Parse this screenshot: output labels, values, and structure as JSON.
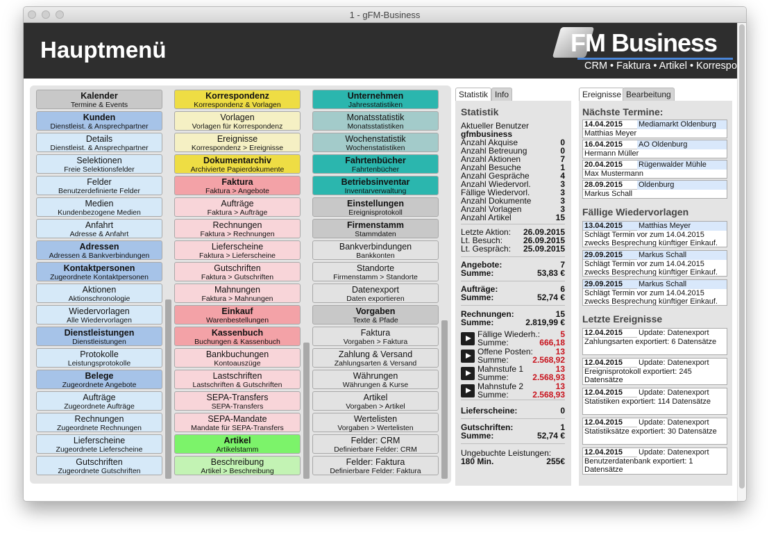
{
  "window": {
    "title": "1 - gFM-Business"
  },
  "header": {
    "title": "Hauptmenü",
    "logo_text": "FM Business",
    "logo_sub": "CRM • Faktura • Artikel • Korrespondenz"
  },
  "columns": [
    [
      {
        "t": "Kalender",
        "s": "Termine & Events",
        "v": "grey",
        "b": true
      },
      {
        "t": "Kunden",
        "s": "Dienstleist. & Ansprechpartner",
        "v": "dblue",
        "b": true
      },
      {
        "t": "Details",
        "s": "Dienstleist. & Ansprechpartner",
        "v": "lblue",
        "b": false
      },
      {
        "t": "Selektionen",
        "s": "Freie Selektionsfelder",
        "v": "lblue",
        "b": false
      },
      {
        "t": "Felder",
        "s": "Benutzerdefinierte Felder",
        "v": "lblue",
        "b": false
      },
      {
        "t": "Medien",
        "s": "Kundenbezogene Medien",
        "v": "lblue",
        "b": false
      },
      {
        "t": "Anfahrt",
        "s": "Adresse & Anfahrt",
        "v": "lblue",
        "b": false
      },
      {
        "t": "Adressen",
        "s": "Adressen & Bankverbindungen",
        "v": "dblue",
        "b": true
      },
      {
        "t": "Kontaktpersonen",
        "s": "Zugeordnete Kontaktpersonen",
        "v": "dblue",
        "b": true
      },
      {
        "t": "Aktionen",
        "s": "Aktionschronologie",
        "v": "lblue",
        "b": false
      },
      {
        "t": "Wiedervorlagen",
        "s": "Alle Wiedervorlagen",
        "v": "lblue",
        "b": false
      },
      {
        "t": "Dienstleistungen",
        "s": "Dienstleistungen",
        "v": "dblue",
        "b": true
      },
      {
        "t": "Protokolle",
        "s": "Leistungsprotokolle",
        "v": "lblue",
        "b": false
      },
      {
        "t": "Belege",
        "s": "Zugeordnete Angebote",
        "v": "dblue",
        "b": true
      },
      {
        "t": "Aufträge",
        "s": "Zugeordnete Aufträge",
        "v": "lblue",
        "b": false
      },
      {
        "t": "Rechnungen",
        "s": "Zugeordnete Rechnungen",
        "v": "lblue",
        "b": false
      },
      {
        "t": "Lieferscheine",
        "s": "Zugeordnete Lieferscheine",
        "v": "lblue",
        "b": false
      },
      {
        "t": "Gutschriften",
        "s": "Zugeordnete Gutschriften",
        "v": "lblue",
        "b": false
      }
    ],
    [
      {
        "t": "Korrespondenz",
        "s": "Korrespondenz & Vorlagen",
        "v": "yellow",
        "b": true
      },
      {
        "t": "Vorlagen",
        "s": "Vorlagen für Korrespondenz",
        "v": "lyellow",
        "b": false
      },
      {
        "t": "Ereignisse",
        "s": "Korrespondenz > Ereignisse",
        "v": "lyellow",
        "b": false
      },
      {
        "t": "Dokumentarchiv",
        "s": "Archivierte Papierdokumente",
        "v": "yellow",
        "b": true
      },
      {
        "t": "Faktura",
        "s": "Faktura > Angebote",
        "v": "dpink",
        "b": true
      },
      {
        "t": "Aufträge",
        "s": "Faktura > Aufträge",
        "v": "lpink",
        "b": false
      },
      {
        "t": "Rechnungen",
        "s": "Faktura > Rechnungen",
        "v": "lpink",
        "b": false
      },
      {
        "t": "Lieferscheine",
        "s": "Faktura > Lieferscheine",
        "v": "lpink",
        "b": false
      },
      {
        "t": "Gutschriften",
        "s": "Faktura > Gutschriften",
        "v": "lpink",
        "b": false
      },
      {
        "t": "Mahnungen",
        "s": "Faktura > Mahnungen",
        "v": "lpink",
        "b": false
      },
      {
        "t": "Einkauf",
        "s": "Warenbestellungen",
        "v": "dpink",
        "b": true
      },
      {
        "t": "Kassenbuch",
        "s": "Buchungen & Kassenbuch",
        "v": "dpink",
        "b": true
      },
      {
        "t": "Bankbuchungen",
        "s": "Kontoauszüge",
        "v": "lpink",
        "b": false
      },
      {
        "t": "Lastschriften",
        "s": "Lastschriften & Gutschriften",
        "v": "lpink",
        "b": false
      },
      {
        "t": "SEPA-Transfers",
        "s": "SEPA-Transfers",
        "v": "lpink",
        "b": false
      },
      {
        "t": "SEPA-Mandate",
        "s": "Mandate für SEPA-Transfers",
        "v": "lpink",
        "b": false
      },
      {
        "t": "Artikel",
        "s": "Artikelstamm",
        "v": "green",
        "b": true
      },
      {
        "t": "Beschreibung",
        "s": "Artikel > Beschreibung",
        "v": "lgreen",
        "b": false
      }
    ],
    [
      {
        "t": "Unternehmen",
        "s": "Jahresstatistiken",
        "v": "dteal",
        "b": true
      },
      {
        "t": "Monatsstatistik",
        "s": "Monatsstatistiken",
        "v": "lteal",
        "b": false
      },
      {
        "t": "Wochenstatistik",
        "s": "Wochenstatistiken",
        "v": "lteal",
        "b": false
      },
      {
        "t": "Fahrtenbücher",
        "s": "Fahrtenbücher",
        "v": "dteal",
        "b": true
      },
      {
        "t": "Betriebsinventar",
        "s": "Inventarverwaltung",
        "v": "dteal",
        "b": true
      },
      {
        "t": "Einstellungen",
        "s": "Ereignisprotokoll",
        "v": "grey",
        "b": true
      },
      {
        "t": "Firmenstamm",
        "s": "Stammdaten",
        "v": "grey",
        "b": true
      },
      {
        "t": "Bankverbindungen",
        "s": "Bankkonten",
        "v": "lgrey",
        "b": false
      },
      {
        "t": "Standorte",
        "s": "Firmenstamm > Standorte",
        "v": "lgrey",
        "b": false
      },
      {
        "t": "Datenexport",
        "s": "Daten exportieren",
        "v": "lgrey",
        "b": false
      },
      {
        "t": "Vorgaben",
        "s": "Texte & Pfade",
        "v": "grey",
        "b": true
      },
      {
        "t": "Faktura",
        "s": "Vorgaben > Faktura",
        "v": "lgrey",
        "b": false
      },
      {
        "t": "Zahlung & Versand",
        "s": "Zahlungsarten & Versand",
        "v": "lgrey",
        "b": false
      },
      {
        "t": "Währungen",
        "s": "Währungen & Kurse",
        "v": "lgrey",
        "b": false
      },
      {
        "t": "Artikel",
        "s": "Vorgaben > Artikel",
        "v": "lgrey",
        "b": false
      },
      {
        "t": "Wertelisten",
        "s": "Vorgaben > Wertelisten",
        "v": "lgrey",
        "b": false
      },
      {
        "t": "Felder: CRM",
        "s": "Definierbare Felder: CRM",
        "v": "lgrey",
        "b": false
      },
      {
        "t": "Felder: Faktura",
        "s": "Definierbare Felder: Faktura",
        "v": "lgrey",
        "b": false
      }
    ]
  ],
  "stats": {
    "tabs": [
      "Statistik",
      "Info"
    ],
    "title": "Statistik",
    "user_label": "Aktueller Benutzer",
    "user": "gfmbusiness",
    "counts": [
      {
        "k": "Anzahl Akquise",
        "v": "0"
      },
      {
        "k": "Anzahl Betreuung",
        "v": "0"
      },
      {
        "k": "Anzahl Aktionen",
        "v": "7"
      },
      {
        "k": "Anzahl Besuche",
        "v": "1"
      },
      {
        "k": "Anzahl Gespräche",
        "v": "4"
      },
      {
        "k": "Anzahl Wiedervorl.",
        "v": "3"
      },
      {
        "k": "Fällige Wiedervorl.",
        "v": "3"
      },
      {
        "k": "Anzahl Dokumente",
        "v": "3"
      },
      {
        "k": "Anzahl Vorlagen",
        "v": "3"
      },
      {
        "k": "Anzahl Artikel",
        "v": "15"
      }
    ],
    "dates": [
      {
        "k": "Letzte Aktion:",
        "v": "26.09.2015"
      },
      {
        "k": "Lt. Besuch:",
        "v": "26.09.2015"
      },
      {
        "k": "Lt. Gespräch:",
        "v": "25.09.2015"
      }
    ],
    "angebote": {
      "k": "Angebote:",
      "v": "7",
      "sk": "Summe:",
      "sv": "53,83 €"
    },
    "auftraege": {
      "k": "Aufträge:",
      "v": "6",
      "sk": "Summe:",
      "sv": "52,74 €"
    },
    "rechnungen": {
      "k": "Rechnungen:",
      "v": "15",
      "sk": "Summe:",
      "sv": "2.819,99 €"
    },
    "subs": [
      {
        "k": "Fällige Wiederh.:",
        "v": "5",
        "sk": "Summe:",
        "sv": "666,18"
      },
      {
        "k": "Offene Posten:",
        "v": "13",
        "sk": "Summe:",
        "sv": "2.568,92"
      },
      {
        "k": "Mahnstufe 1",
        "v": "13",
        "sk": "Summe:",
        "sv": "2.568,93"
      },
      {
        "k": "Mahnstufe 2",
        "v": "13",
        "sk": "Summe:",
        "sv": "2.568,93"
      }
    ],
    "lieferscheine": {
      "k": "Lieferscheine:",
      "v": "0"
    },
    "gutschriften": {
      "k": "Gutschriften:",
      "v": "1",
      "sk": "Summe:",
      "sv": "52,74 €"
    },
    "ungebucht": {
      "k": "Ungebuchte Leistungen:",
      "k2": "180 Min.",
      "v": "255€"
    }
  },
  "events": {
    "tabs": [
      "Ereignisse",
      "Bearbeitung"
    ],
    "termine_title": "Nächste Termine:",
    "termine": [
      {
        "date": "14.04.2015",
        "name": "Mediamarkt Oldenburg",
        "person": "Matthias Meyer"
      },
      {
        "date": "16.04.2015",
        "name": "AO Oldenburg",
        "person": "Hermann Müller"
      },
      {
        "date": "20.04.2015",
        "name": "Rügenwalder Mühle",
        "person": "Max Mustermann"
      },
      {
        "date": "28.09.2015",
        "name": "Oldenburg",
        "person": "Markus Schall"
      }
    ],
    "wv_title": "Fällige Wiedervorlagen",
    "wiedervorlagen": [
      {
        "date": "13.04.2015",
        "name": "Matthias Meyer",
        "text": "Schlägt Termin vor zum 14.04.2015 zwecks Besprechung künftiger Einkauf. Vorlage auf Sachen"
      },
      {
        "date": "29.09.2015",
        "name": "Markus Schall",
        "text": "Schlägt Termin vor zum 14.04.2015 zwecks Besprechung künftiger Einkauf. Vorlage auf Sachen"
      },
      {
        "date": "29.09.2015",
        "name": "Markus Schall",
        "text": "Schlägt Termin vor zum 14.04.2015 zwecks Besprechung künftiger Einkauf. Vorlage auf Sachen"
      }
    ],
    "ev_title": "Letzte Ereignisse",
    "ereignisse": [
      {
        "date": "12.04.2015",
        "name": "Update: Datenexport",
        "text": "Zahlungsarten exportiert: 6 Datensätze"
      },
      {
        "date": "12.04.2015",
        "name": "Update: Datenexport",
        "text": "Ereignisprotokoll exportiert: 245 Datensätze"
      },
      {
        "date": "12.04.2015",
        "name": "Update: Datenexport",
        "text": "Statistiken exportiert: 114 Datensätze"
      },
      {
        "date": "12.04.2015",
        "name": "Update: Datenexport",
        "text": "Statistiksätze exportiert: 30 Datensätze"
      },
      {
        "date": "12.04.2015",
        "name": "Update: Datenexport",
        "text": "Benutzerdatenbank exportiert: 1 Datensätze"
      }
    ]
  }
}
